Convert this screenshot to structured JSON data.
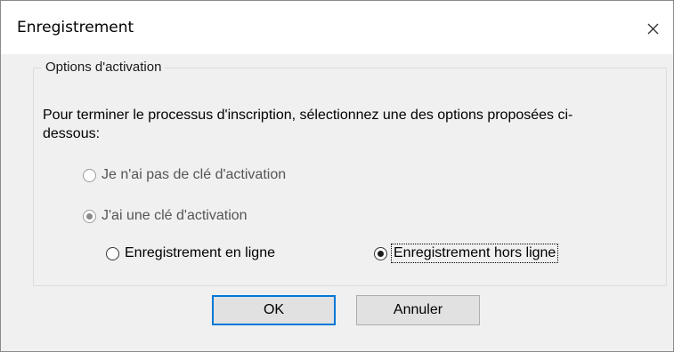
{
  "window": {
    "title": "Enregistrement",
    "close_icon": "close-icon"
  },
  "group": {
    "legend": "Options d'activation",
    "instructions": "Pour terminer le processus d'inscription, sélectionnez une des options proposées ci-dessous:"
  },
  "options": {
    "no_key": {
      "label": "Je n'ai pas de clé d'activation",
      "selected": false,
      "enabled": false
    },
    "have_key": {
      "label": "J'ai une clé d'activation",
      "selected": true,
      "enabled": false
    },
    "online": {
      "label": "Enregistrement en ligne",
      "selected": false,
      "enabled": true
    },
    "offline": {
      "label": "Enregistrement hors ligne",
      "selected": true,
      "enabled": true,
      "focused": true
    }
  },
  "buttons": {
    "ok": "OK",
    "cancel": "Annuler"
  },
  "colors": {
    "focus_border": "#0078d7",
    "dialog_bg": "#f0f0f0",
    "titlebar_bg": "#ffffff"
  }
}
